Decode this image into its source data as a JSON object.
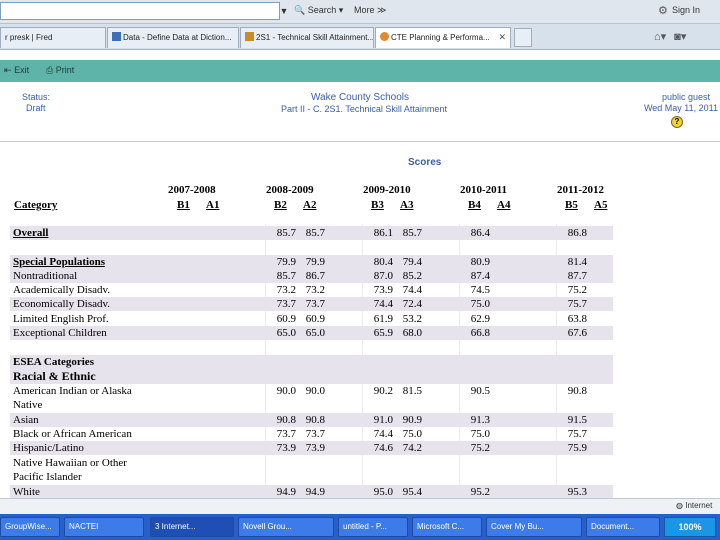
{
  "browser": {
    "search_label": "Search",
    "more_label": "More ≫",
    "signin_label": "Sign In",
    "tabs": [
      {
        "label": "r presk | Fred"
      },
      {
        "label": "Data - Define Data at Diction..."
      },
      {
        "label": "2S1 - Technical Skill Attainment..."
      },
      {
        "label": "CTE Planning & Performa..."
      }
    ]
  },
  "toolbar": {
    "exit_label": "Exit",
    "print_label": "Print"
  },
  "header": {
    "status_label": "Status:",
    "status_value": "Draft",
    "school": "Wake County Schools",
    "part": "Part II - C. 2S1. Technical Skill Attainment",
    "user": "public guest",
    "date": "Wed  May 11, 2011"
  },
  "scores": {
    "title": "Scores",
    "category_header": "Category",
    "years": [
      "2007-2008",
      "2008-2009",
      "2009-2010",
      "2010-2011",
      "2011-2012"
    ],
    "subheaders": [
      [
        "B1",
        "A1"
      ],
      [
        "B2",
        "A2"
      ],
      [
        "B3",
        "A3"
      ],
      [
        "B4",
        "A4"
      ],
      [
        "B5",
        "A5"
      ]
    ],
    "rows": [
      {
        "label": "Overall",
        "bold": true,
        "vals": [
          "",
          "",
          "85.7",
          "85.7",
          "86.1",
          "85.7",
          "86.4",
          "",
          "86.8",
          ""
        ]
      },
      {
        "label": "Special Populations",
        "bold": true,
        "vals": [
          "",
          "",
          "79.9",
          "79.9",
          "80.4",
          "79.4",
          "80.9",
          "",
          "81.4",
          ""
        ]
      },
      {
        "label": "Nontraditional",
        "bold": false,
        "vals": [
          "",
          "",
          "85.7",
          "86.7",
          "87.0",
          "85.2",
          "87.4",
          "",
          "87.7",
          ""
        ]
      },
      {
        "label": "Academically Disadv.",
        "bold": false,
        "vals": [
          "",
          "",
          "73.2",
          "73.2",
          "73.9",
          "74.4",
          "74.5",
          "",
          "75.2",
          ""
        ]
      },
      {
        "label": "Economically Disadv.",
        "bold": false,
        "vals": [
          "",
          "",
          "73.7",
          "73.7",
          "74.4",
          "72.4",
          "75.0",
          "",
          "75.7",
          ""
        ]
      },
      {
        "label": "Limited English Prof.",
        "bold": false,
        "vals": [
          "",
          "",
          "60.9",
          "60.9",
          "61.9",
          "53.2",
          "62.9",
          "",
          "63.8",
          ""
        ]
      },
      {
        "label": "Exceptional Children",
        "bold": false,
        "vals": [
          "",
          "",
          "65.0",
          "65.0",
          "65.9",
          "68.0",
          "66.8",
          "",
          "67.6",
          ""
        ]
      },
      {
        "label": "ESEA Categories",
        "bold": true,
        "vals": [
          "",
          "",
          "",
          "",
          "",
          "",
          "",
          "",
          "",
          ""
        ]
      },
      {
        "label": "Racial & Ethnic",
        "bold": true,
        "vals": [
          "",
          "",
          "",
          "",
          "",
          "",
          "",
          "",
          "",
          ""
        ]
      },
      {
        "label": "American Indian or Alaska",
        "bold": false,
        "vals": [
          "",
          "",
          "90.0",
          "90.0",
          "90.2",
          "81.5",
          "90.5",
          "",
          "90.8",
          ""
        ]
      },
      {
        "label": "Native",
        "bold": false,
        "vals": [
          "",
          "",
          "",
          "",
          "",
          "",
          "",
          "",
          "",
          ""
        ]
      },
      {
        "label": "Asian",
        "bold": false,
        "vals": [
          "",
          "",
          "90.8",
          "90.8",
          "91.0",
          "90.9",
          "91.3",
          "",
          "91.5",
          ""
        ]
      },
      {
        "label": "Black or African American",
        "bold": false,
        "vals": [
          "",
          "",
          "73.7",
          "73.7",
          "74.4",
          "75.0",
          "75.0",
          "",
          "75.7",
          ""
        ]
      },
      {
        "label": "Hispanic/Latino",
        "bold": false,
        "vals": [
          "",
          "",
          "73.9",
          "73.9",
          "74.6",
          "74.2",
          "75.2",
          "",
          "75.9",
          ""
        ]
      },
      {
        "label": "Native Hawaiian or Other",
        "bold": false,
        "vals": [
          "",
          "",
          "",
          "",
          "",
          "",
          "",
          "",
          "",
          ""
        ]
      },
      {
        "label": "Pacific Islander",
        "bold": false,
        "vals": [
          "",
          "",
          "",
          "",
          "",
          "",
          "",
          "",
          "",
          ""
        ]
      },
      {
        "label": "White",
        "bold": false,
        "vals": [
          "",
          "",
          "94.9",
          "94.9",
          "95.0",
          "95.4",
          "95.2",
          "",
          "95.3",
          ""
        ]
      }
    ]
  },
  "statusbar": {
    "zone": "Internet"
  },
  "taskbar": {
    "items": [
      {
        "label": "GroupWise..."
      },
      {
        "label": "NACTEI"
      },
      {
        "label": "3 Internet..."
      },
      {
        "label": "Novell Grou..."
      },
      {
        "label": "untitled - P..."
      },
      {
        "label": "Microsoft C..."
      },
      {
        "label": "Cover My Bu..."
      },
      {
        "label": "Document..."
      }
    ],
    "zoom": "100%"
  }
}
